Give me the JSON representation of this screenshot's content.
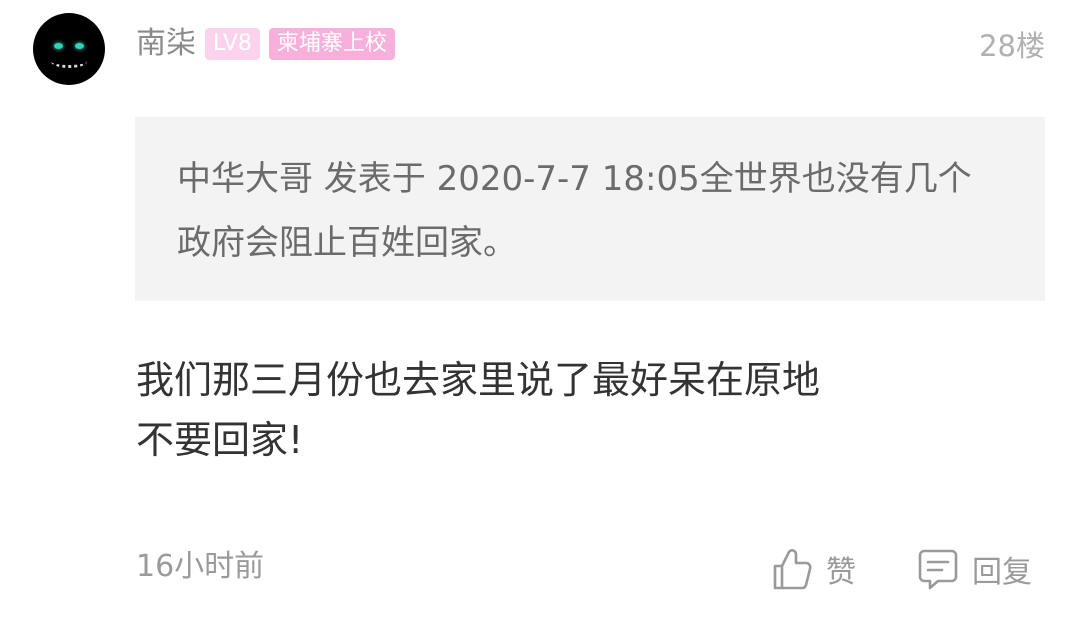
{
  "post": {
    "username": "南柒",
    "level_badge": "LV8",
    "title_badge": "柬埔寨上校",
    "floor": "28楼",
    "quote": "中华大哥 发表于 2020-7-7 18:05全世界也没有几个政府会阻止百姓回家。",
    "content_line1": "我们那三月份也去家里说了最好呆在原地",
    "content_line2": "不要回家!",
    "time": "16小时前",
    "like_label": "赞",
    "reply_label": "回复"
  },
  "colors": {
    "level_badge_bg": "#fdd2ec",
    "title_badge_bg": "#f7b0dc",
    "quote_bg": "#f3f3f3"
  },
  "icons": {
    "avatar": "cheshire-cat-avatar",
    "like": "thumbs-up-icon",
    "reply": "comment-icon"
  }
}
